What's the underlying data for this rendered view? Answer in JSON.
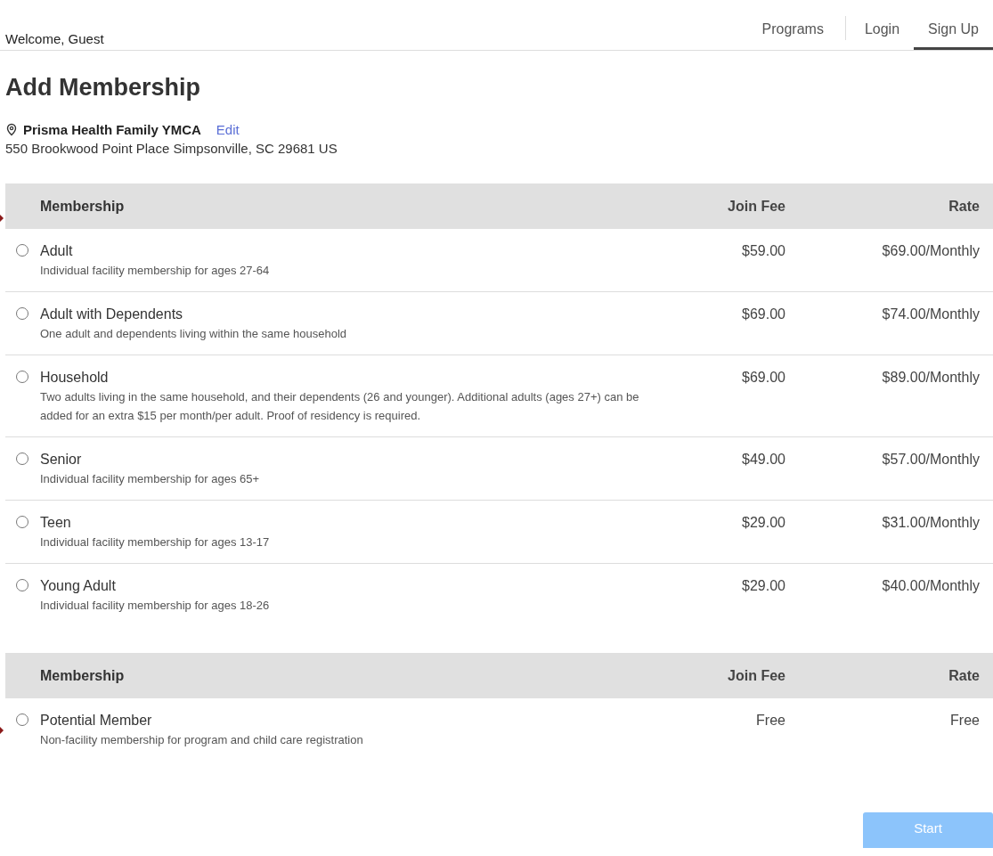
{
  "header": {
    "welcome": "Welcome, Guest",
    "nav": [
      {
        "label": "Programs",
        "selected": false
      },
      {
        "label": "Login",
        "selected": false
      },
      {
        "label": "Sign Up",
        "selected": true
      }
    ]
  },
  "title": "Add Membership",
  "location": {
    "name": "Prisma Health Family YMCA",
    "edit_link": "Edit",
    "address": "550 Brookwood Point Place Simpsonville, SC 29681 US"
  },
  "tables": [
    {
      "columns": [
        "Membership",
        "Join Fee",
        "Rate"
      ],
      "rows": [
        {
          "name": "Adult",
          "description": "Individual facility membership for ages 27-64",
          "join_fee": "$59.00",
          "rate": "$69.00/Monthly",
          "selected": false
        },
        {
          "name": "Adult with Dependents",
          "description": "One adult and dependents living within the same household",
          "join_fee": "$69.00",
          "rate": "$74.00/Monthly",
          "selected": false
        },
        {
          "name": "Household",
          "description": "Two adults living in the same household, and their dependents (26 and younger). Additional adults (ages 27+) can be added for an extra $15 per month/per adult. Proof of residency is required.",
          "join_fee": "$69.00",
          "rate": "$89.00/Monthly",
          "selected": false
        },
        {
          "name": "Senior",
          "description": "Individual facility membership for ages 65+",
          "join_fee": "$49.00",
          "rate": "$57.00/Monthly",
          "selected": false
        },
        {
          "name": "Teen",
          "description": "Individual facility membership for ages 13-17",
          "join_fee": "$29.00",
          "rate": "$31.00/Monthly",
          "selected": false
        },
        {
          "name": "Young Adult",
          "description": "Individual facility membership for ages 18-26",
          "join_fee": "$29.00",
          "rate": "$40.00/Monthly",
          "selected": false
        }
      ]
    },
    {
      "columns": [
        "Membership",
        "Join Fee",
        "Rate"
      ],
      "rows": [
        {
          "name": "Potential Member",
          "description": "Non-facility membership for program and child care registration",
          "join_fee": "Free",
          "rate": "Free",
          "selected": false
        }
      ]
    }
  ],
  "start_button": {
    "label": "Start",
    "disabled": true
  }
}
